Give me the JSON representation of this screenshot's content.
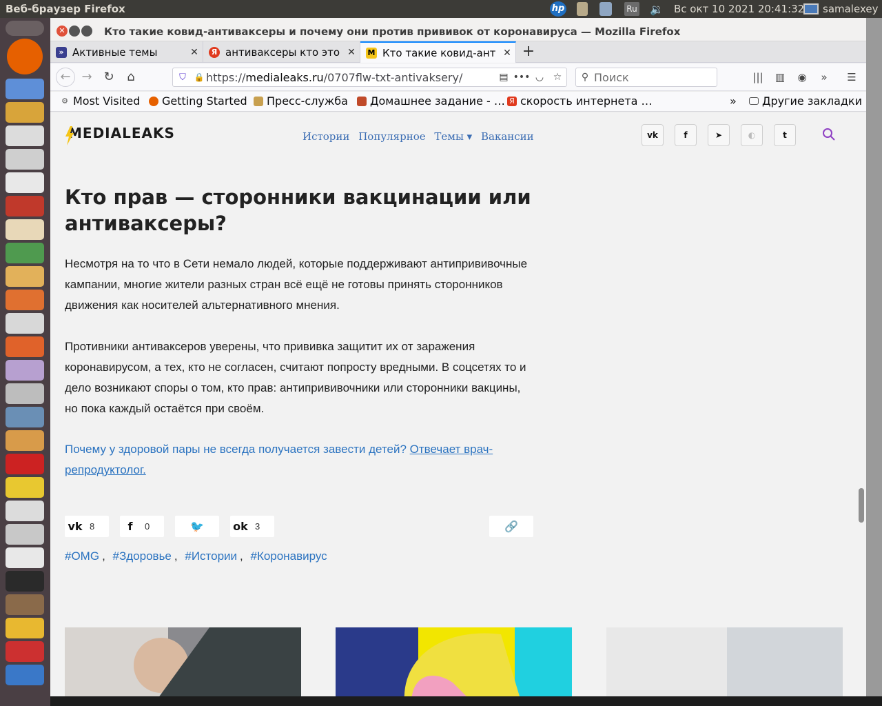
{
  "panel": {
    "app_title": "Веб-браузер Firefox",
    "clock": "Вс окт 10 2021 20:41:32",
    "user": "samalexey",
    "keyboard_layout": "Ru"
  },
  "window": {
    "title": "Кто такие ковид-антиваксеры и почему они против прививок от коронавируса — Mozilla Firefox"
  },
  "tabs": [
    {
      "label": "Активные темы",
      "favicon": "forum-icon",
      "color": "#3a3f8f"
    },
    {
      "label": "антиваксеры кто это",
      "favicon": "yandex-icon",
      "color": "#e03a1e"
    },
    {
      "label": "Кто такие ковид-ант",
      "favicon": "medialeaks-icon",
      "color": "#f5c518"
    }
  ],
  "navbar": {
    "url_prefix": "https://",
    "url_domain": "medialeaks.ru",
    "url_path": "/0707flw-txt-antivaksery/",
    "search_placeholder": "Поиск"
  },
  "bookmarks": [
    {
      "label": "Most Visited",
      "icon": "gear-icon"
    },
    {
      "label": "Getting Started",
      "icon": "firefox-icon"
    },
    {
      "label": "Пресс-служба",
      "icon": "emblem-icon"
    },
    {
      "label": "Домашнее задание - …",
      "icon": "school-icon"
    },
    {
      "label": "скорость интернета …",
      "icon": "yandex-icon"
    },
    {
      "label": "Другие закладки",
      "icon": "folder-icon"
    }
  ],
  "site": {
    "logo": "MEDIALEAKS",
    "nav": [
      "Истории",
      "Популярное",
      "Темы ▾",
      "Вакансии"
    ],
    "social": [
      "vk",
      "facebook",
      "telegram",
      "yandex-zen",
      "twitter"
    ]
  },
  "article": {
    "title": "Кто прав — сторонники вакцинации или антиваксеры?",
    "paragraph1": "Несмотря на то что в Сети немало людей, которые поддерживают антипрививочные кампании, многие жители разных стран всё ещё не готовы принять сторонников движения как носителей альтернативного мнения.",
    "paragraph2": "Противники антиваксеров уверены, что прививка защитит их от заражения коронавирусом, а тех, кто не согласен, считают попросту вредными. В соцсетях то и дело возникают споры о том, кто прав: антипрививочники или сторонники вакцины, но пока каждый остаётся при своём.",
    "promo_text": "Почему у здоровой пары не всегда получается завести детей?",
    "promo_link": "Отвечает врач-репродуктолог."
  },
  "share": {
    "vk_count": "8",
    "fb_count": "0",
    "ok_count": "3"
  },
  "tags": [
    "#OMG",
    "#Здоровье",
    "#Истории",
    "#Коронавирус"
  ]
}
